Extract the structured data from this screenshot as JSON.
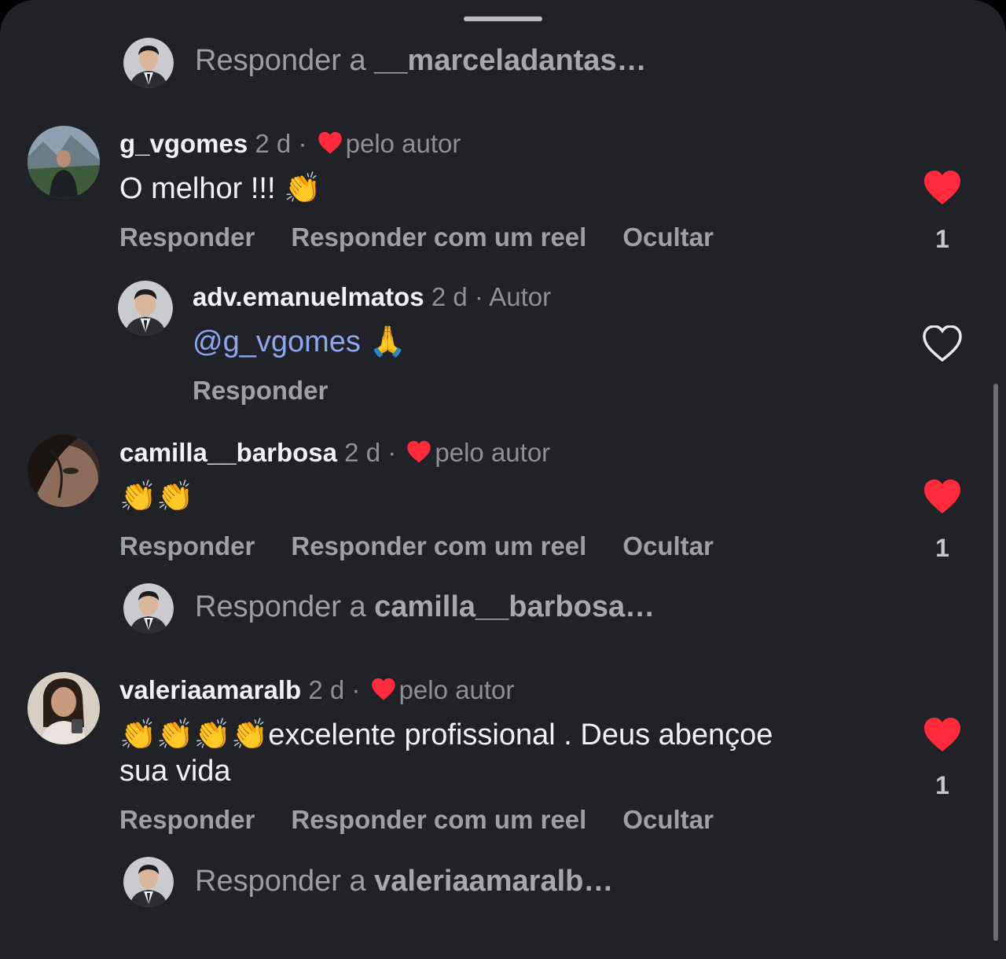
{
  "colors": {
    "background": "#212227",
    "heart": "#ff2a3b",
    "mention": "#8fa6ee"
  },
  "reply_prompt": "Responder a ",
  "reply_top": {
    "target": "__marceladantas…"
  },
  "comments": [
    {
      "username": "g_vgomes",
      "age": "2 d ·",
      "liked_by": "pelo autor",
      "text": "O melhor !!!",
      "emoji": "👏",
      "actions": [
        "Responder",
        "Responder com um reel",
        "Ocultar"
      ],
      "likes": "1",
      "liked": true
    },
    {
      "username": "camilla__barbosa",
      "age": "2 d ·",
      "liked_by": "pelo autor",
      "emoji": "👏👏",
      "actions": [
        "Responder",
        "Responder com um reel",
        "Ocultar"
      ],
      "likes": "1",
      "liked": true,
      "reply_target": "camilla__barbosa…"
    },
    {
      "username": "valeriaamaralb",
      "age": "2 d ·",
      "liked_by": "pelo autor",
      "emoji": "👏👏👏👏",
      "text_line1": "excelente profissional . Deus abençoe",
      "text_line2": "sua vida",
      "actions": [
        "Responder",
        "Responder com um reel",
        "Ocultar"
      ],
      "likes": "1",
      "liked": true,
      "reply_target": "valeriaamaralb…"
    }
  ],
  "author_reply": {
    "username": "adv.emanuelmatos",
    "age": "2 d ·",
    "badge": "Autor",
    "mention": "@g_vgomes",
    "emoji": "🙏",
    "action": "Responder",
    "liked": false
  }
}
